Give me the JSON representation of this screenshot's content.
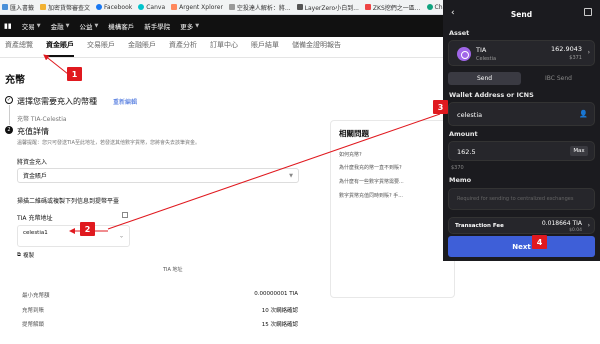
{
  "bookmarks": [
    "匯入書籤",
    "加密貨幣審查文",
    "Facebook",
    "Canva",
    "Argent Xplorer",
    "空投達人解析：將...",
    "LayerZero小白到...",
    "ZKS挖們之一區...",
    "ChatGPT"
  ],
  "nav": [
    {
      "label": "交易"
    },
    {
      "label": "金融"
    },
    {
      "label": "公益"
    },
    {
      "label": "機構客戶"
    },
    {
      "label": "新手學院"
    },
    {
      "label": "更多"
    }
  ],
  "subnav": [
    "資產總覽",
    "資金賬戶",
    "交易賬戶",
    "金融賬戶",
    "資產分析",
    "訂單中心",
    "賬戶結單",
    "儲備金證明報告"
  ],
  "page_title": "充幣",
  "steps": {
    "step1_title": "選擇您需要充入的幣種",
    "step1_num": "✓",
    "step1_link": "重新編輯",
    "step1_sub": "充幣 TIA-Celestia",
    "step2_title": "充值詳情",
    "step2_num": "2",
    "step2_note": "溫馨提醒：您只可發送TIA至此地址，若發送其他數字貨幣，您將會失去該筆資金。"
  },
  "form": {
    "account_label": "將資金充入",
    "account_value": "資金賬戶",
    "scan_note": "掃描二維碼或複製下列信息到提幣平臺",
    "address_label": "TIA 充幣地址",
    "network_value": "celestia1",
    "copy_label": "複製",
    "tia_addr_label": "TIA 地址"
  },
  "details": [
    {
      "k": "最小充幣額",
      "v": "0.00000001 TIA"
    },
    {
      "k": "充幣到賬",
      "v": "10 次網絡確認"
    },
    {
      "k": "提幣解鎖",
      "v": "15 次網絡確認"
    }
  ],
  "faq": {
    "title": "相關問題",
    "items": [
      "如何充幣?",
      "為什麼我充的幣一直不到賬?",
      "為什麼有一些數字貨幣需要...",
      "數字貨幣充值同時到賬? 手..."
    ]
  },
  "badges": [
    "1",
    "2",
    "3",
    "4"
  ],
  "wallet": {
    "title": "Send",
    "asset_label": "Asset",
    "asset_symbol": "TIA",
    "asset_chain": "Celestia",
    "asset_amount": "162.9043",
    "asset_usd": "$371",
    "tab_send": "Send",
    "tab_ibc": "IBC Send",
    "address_label": "Wallet Address or ICNS",
    "address_value": "celestia",
    "amount_label": "Amount",
    "amount_value": "162.5",
    "max_label": "Max",
    "amount_usd": "$370",
    "memo_label": "Memo",
    "memo_placeholder": "Required for sending to centralized exchanges",
    "fee_label": "Transaction Fee",
    "fee_value": "0.018664 TIA",
    "fee_usd": "$0.04",
    "next_label": "Next"
  },
  "colors": {
    "annotation": "#e0191f",
    "wallet_bg": "#1b1b1f",
    "accent": "#3e5fd8"
  }
}
